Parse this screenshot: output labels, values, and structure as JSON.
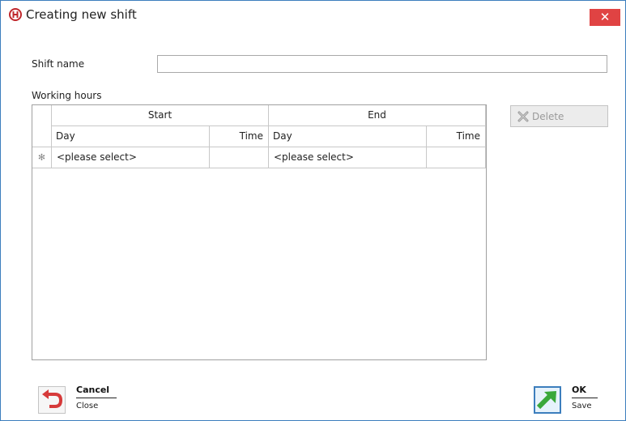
{
  "window": {
    "title": "Creating new shift",
    "close_glyph": "✕",
    "accent_color": "#3c7ebd",
    "close_color": "#e04343"
  },
  "form": {
    "shift_name_label": "Shift name",
    "shift_name_value": "",
    "working_hours_label": "Working hours"
  },
  "grid": {
    "group_start": "Start",
    "group_end": "End",
    "columns": [
      "Day",
      "Time",
      "Day",
      "Time"
    ],
    "new_row_marker": "✻",
    "new_row": {
      "start_day": "<please select>",
      "start_time": "",
      "end_day": "<please select>",
      "end_time": ""
    }
  },
  "toolbar": {
    "delete_label": "Delete"
  },
  "footer": {
    "cancel_title": "Cancel",
    "cancel_sub": "Close",
    "ok_title": "OK",
    "ok_sub": "Save"
  },
  "icons": {
    "app": "app-logo-icon",
    "delete": "delete-x-icon",
    "cancel": "undo-arrow-icon",
    "ok": "green-arrow-icon"
  }
}
